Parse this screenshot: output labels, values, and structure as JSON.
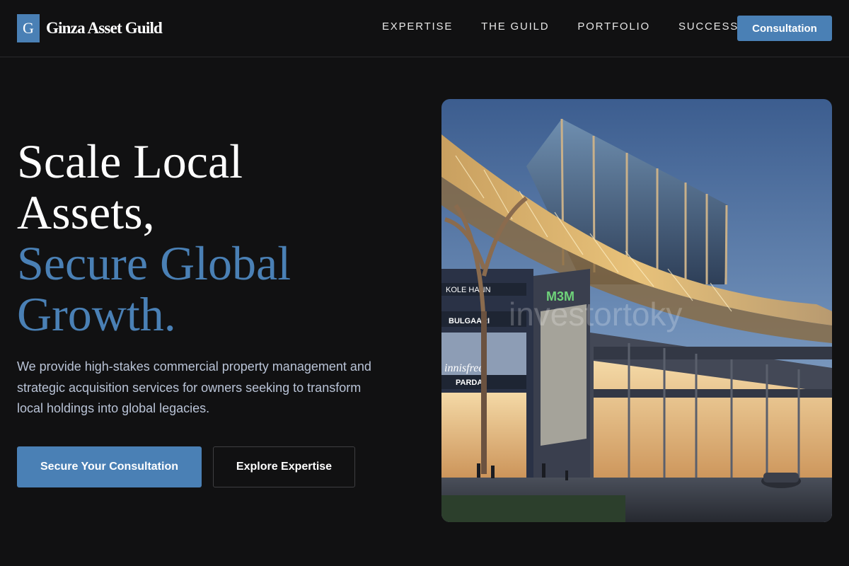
{
  "brand": {
    "mark": "G",
    "name": "Ginza Asset Guild"
  },
  "nav": {
    "links": [
      "EXPERTISE",
      "THE GUILD",
      "PORTFOLIO",
      "SUCCESS"
    ],
    "cta_label": "Consultation"
  },
  "hero": {
    "title_line1": "Scale Local",
    "title_line2": "Assets,",
    "title_accent_line1": "Secure Global",
    "title_accent_line2": "Growth.",
    "description": "We provide high-stakes commercial property management and strategic acquisition services for owners seeking to transform local holdings into global legacies.",
    "primary_button": "Secure Your Consultation",
    "secondary_button": "Explore Expertise"
  },
  "hero_image": {
    "subject": "commercial mall building at dusk",
    "signs": [
      "KOLE HANN",
      "BULGAARI",
      "PARDA",
      "M3M",
      "innisfree"
    ],
    "watermark": "investortoky"
  },
  "colors": {
    "background": "#111112",
    "accent": "#4a80b5",
    "text_primary": "#ffffff",
    "text_muted": "#b9c3d6",
    "border": "#2a2a2c"
  }
}
